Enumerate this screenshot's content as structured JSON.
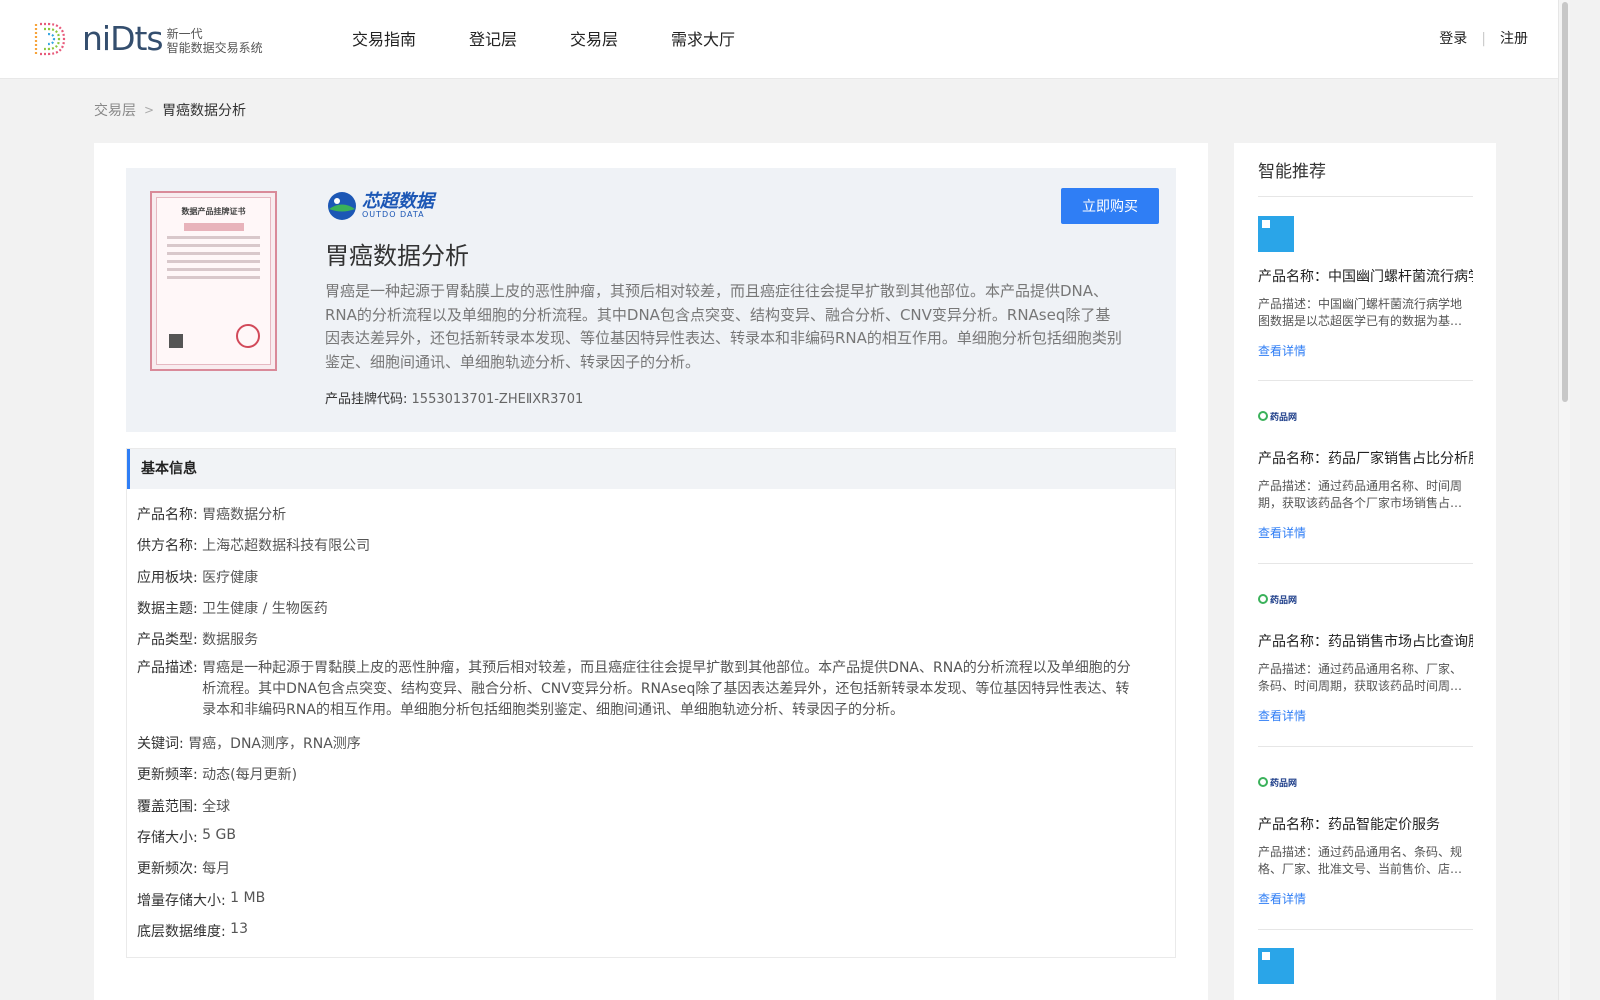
{
  "header": {
    "logo_word": "niDts",
    "logo_sub_line1": "新一代",
    "logo_sub_line2": "智能数据交易系统",
    "nav": [
      "交易指南",
      "登记层",
      "交易层",
      "需求大厅"
    ],
    "login": "登录",
    "register": "注册"
  },
  "breadcrumb": {
    "parent": "交易层",
    "current": "胃癌数据分析"
  },
  "product": {
    "brand_cn": "芯超数据",
    "brand_en": "OUTDO DATA",
    "buy_label": "立即购买",
    "title": "胃癌数据分析",
    "description": "胃癌是一种起源于胃黏膜上皮的恶性肿瘤，其预后相对较差，而且癌症往往会提早扩散到其他部位。本产品提供DNA、RNA的分析流程以及单细胞的分析流程。其中DNA包含点突变、结构变异、融合分析、CNV变异分析。RNAseq除了基因表达差异外，还包括新转录本发现、等位基因特异性表达、转录本和非编码RNA的相互作用。单细胞分析包括细胞类别鉴定、细胞间通讯、单细胞轨迹分析、转录因子的分析。",
    "code_label": "产品挂牌代码:",
    "code_value": "1553013701-ZHEⅡXR3701",
    "cert_title": "数据产品挂牌证书"
  },
  "basic": {
    "heading": "基本信息",
    "rows": [
      {
        "k": "产品名称:",
        "v": "胃癌数据分析"
      },
      {
        "k": "供方名称:",
        "v": "上海芯超数据科技有限公司"
      },
      {
        "k": "应用板块:",
        "v": "医疗健康"
      },
      {
        "k": "数据主题:",
        "v": "卫生健康 / 生物医药"
      },
      {
        "k": "产品类型:",
        "v": "数据服务"
      },
      {
        "k": "产品描述:",
        "v": "胃癌是一种起源于胃黏膜上皮的恶性肿瘤，其预后相对较差，而且癌症往往会提早扩散到其他部位。本产品提供DNA、RNA的分析流程以及单细胞的分析流程。其中DNA包含点突变、结构变异、融合分析、CNV变异分析。RNAseq除了基因表达差异外，还包括新转录本发现、等位基因特异性表达、转录本和非编码RNA的相互作用。单细胞分析包括细胞类别鉴定、细胞间通讯、单细胞轨迹分析、转录因子的分析。"
      },
      {
        "k": "关键词:",
        "v": "胃癌，DNA测序，RNA测序"
      },
      {
        "k": "更新频率:",
        "v": "动态(每月更新)"
      },
      {
        "k": "覆盖范围:",
        "v": "全球"
      },
      {
        "k": "存储大小:",
        "v": "5 GB"
      },
      {
        "k": "更新频次:",
        "v": "每月"
      },
      {
        "k": "增量存储大小:",
        "v": "1 MB"
      },
      {
        "k": "底层数据维度:",
        "v": "13"
      }
    ]
  },
  "recommend": {
    "title": "智能推荐",
    "items": [
      {
        "name": "产品名称：中国幽门螺杆菌流行病学",
        "desc": "产品描述：中国幽门螺杆菌流行病学地图数据是以芯超医学已有的数据为基…",
        "link": "查看详情",
        "thumb": "thumbnail-icon"
      },
      {
        "name": "产品名称：药品厂家销售占比分析服",
        "desc": "产品描述：通过药品通用名称、时间周期，获取该药品各个厂家市场销售占…",
        "link": "查看详情",
        "thumb": "logo-icon",
        "logo_text": "药品网"
      },
      {
        "name": "产品名称：药品销售市场占比查询服",
        "desc": "产品描述：通过药品通用名称、厂家、条码、时间周期，获取该药品时间周…",
        "link": "查看详情",
        "thumb": "logo-icon",
        "logo_text": "药品网"
      },
      {
        "name": "产品名称：药品智能定价服务",
        "desc": "产品描述：通过药品通用名、条码、规格、厂家、批准文号、当前售价、店…",
        "link": "查看详情",
        "thumb": "logo-icon",
        "logo_text": "药品网"
      }
    ]
  }
}
